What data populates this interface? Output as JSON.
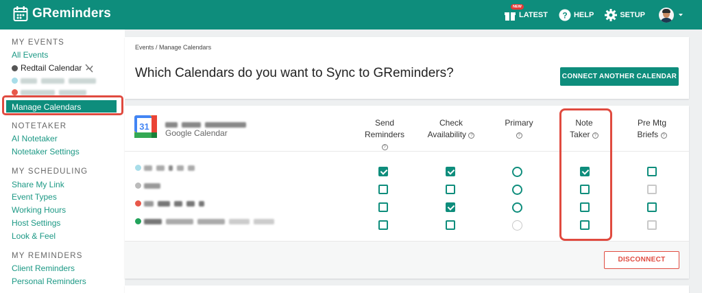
{
  "app": {
    "name": "GReminders"
  },
  "topnav": {
    "latest": "LATEST",
    "new_badge": "NEW",
    "help": "HELP",
    "setup": "SETUP"
  },
  "sidebar": {
    "my_events": {
      "heading": "MY EVENTS",
      "all_events": "All Events",
      "redtail": "Redtail Calendar",
      "manage": "Manage Calendars"
    },
    "notetaker": {
      "heading": "NOTETAKER",
      "ai": "AI Notetaker",
      "settings": "Notetaker Settings"
    },
    "scheduling": {
      "heading": "MY SCHEDULING",
      "share": "Share My Link",
      "types": "Event Types",
      "hours": "Working Hours",
      "host": "Host Settings",
      "look": "Look & Feel"
    },
    "reminders": {
      "heading": "MY REMINDERS",
      "client": "Client Reminders",
      "personal": "Personal Reminders"
    }
  },
  "main": {
    "breadcrumb": "Events / Manage Calendars",
    "title": "Which Calendars do you want to Sync to GReminders?",
    "connect_button": "CONNECT ANOTHER CALENDAR",
    "provider": "Google Calendar",
    "calendar_icon_day": "31",
    "columns": {
      "send": [
        "Send",
        "Reminders"
      ],
      "check": [
        "Check",
        "Availability"
      ],
      "primary": [
        "Primary",
        ""
      ],
      "note": [
        "Note",
        "Taker"
      ],
      "premtg": [
        "Pre Mtg",
        "Briefs"
      ]
    },
    "help_glyph": "?",
    "disconnect_button": "DISCONNECT"
  },
  "colors": {
    "brand": "#0e8d7c",
    "highlight": "#e04a3f"
  }
}
